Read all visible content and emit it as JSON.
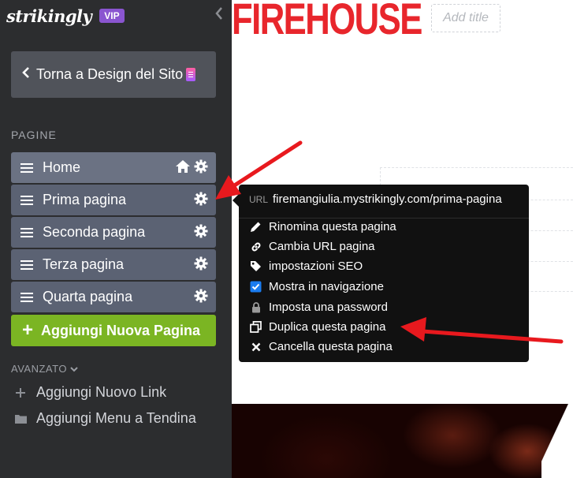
{
  "sidebar": {
    "logo": "strikingly",
    "vip_badge": "VIP",
    "back_button": "Torna a Design del Sito",
    "section_title": "PAGINE",
    "pages": [
      {
        "label": "Home"
      },
      {
        "label": "Prima pagina"
      },
      {
        "label": "Seconda pagina"
      },
      {
        "label": "Terza pagina"
      },
      {
        "label": "Quarta pagina"
      }
    ],
    "add_page": "Aggiungi Nuova Pagina",
    "advanced_label": "AVANZATO",
    "advanced_items": [
      {
        "label": "Aggiungi Nuovo Link",
        "icon": "plus-icon"
      },
      {
        "label": "Aggiungi Menu a Tendina",
        "icon": "folder-icon"
      }
    ]
  },
  "canvas": {
    "site_logo_text": "FIREHOUSE",
    "add_title_placeholder": "Add title"
  },
  "page_menu": {
    "url_label": "URL",
    "url_value": "firemangiulia.mystrikingly.com/prima-pagina",
    "items": [
      {
        "label": "Rinomina questa pagina",
        "icon": "pencil-icon"
      },
      {
        "label": "Cambia URL pagina",
        "icon": "link-icon"
      },
      {
        "label": "impostazioni SEO",
        "icon": "tag-icon"
      },
      {
        "label": "Mostra in navigazione",
        "icon": "checkbox-icon",
        "checked": true
      },
      {
        "label": "Imposta una password",
        "icon": "lock-icon"
      },
      {
        "label": "Duplica questa pagina",
        "icon": "copy-icon"
      },
      {
        "label": "Cancella questa pagina",
        "icon": "x-icon"
      }
    ]
  },
  "colors": {
    "sidebar_bg": "#2c2d2f",
    "page_item_bg": "#5b6273",
    "add_page_green": "#7bb523",
    "vip_purple": "#8a55d0",
    "brand_red": "#e8262c",
    "annotation_arrow": "#e8191e",
    "checkbox_blue": "#1a7cf0"
  }
}
